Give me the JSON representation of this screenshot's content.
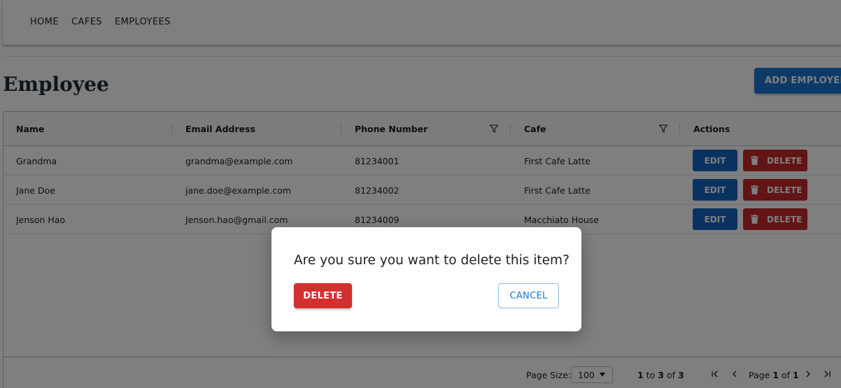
{
  "nav": {
    "items": [
      "HOME",
      "CAFES",
      "EMPLOYEES"
    ]
  },
  "page": {
    "title": "Employee",
    "add_button": "ADD EMPLOYEE"
  },
  "grid": {
    "columns": [
      "Name",
      "Email Address",
      "Phone Number",
      "Cafe",
      "Actions"
    ],
    "rows": [
      {
        "name": "Grandma",
        "email": "grandma@example.com",
        "phone": "81234001",
        "cafe": "First Cafe Latte"
      },
      {
        "name": "Jane Doe",
        "email": "jane.doe@example.com",
        "phone": "81234002",
        "cafe": "First Cafe Latte"
      },
      {
        "name": "Jenson Hao",
        "email": "Jenson.hao@gmail.com",
        "phone": "81234009",
        "cafe": "Macchiato House"
      }
    ],
    "edit_label": "EDIT",
    "delete_label": "DELETE"
  },
  "pagination": {
    "page_size_label": "Page Size:",
    "page_size_value": "100",
    "range_from": "1",
    "to_word": "to",
    "range_to": "3",
    "of_word": "of",
    "total": "3",
    "page_word": "Page",
    "page_current": "1",
    "page_of_word": "of",
    "page_total": "1"
  },
  "dialog": {
    "message": "Are you sure you want to delete this item?",
    "delete_button": "DELETE",
    "cancel_button": "CANCEL"
  },
  "colors": {
    "primary": "#1976d2",
    "danger": "#d32f2f",
    "overlay": "rgba(0,0,0,0.5)"
  }
}
